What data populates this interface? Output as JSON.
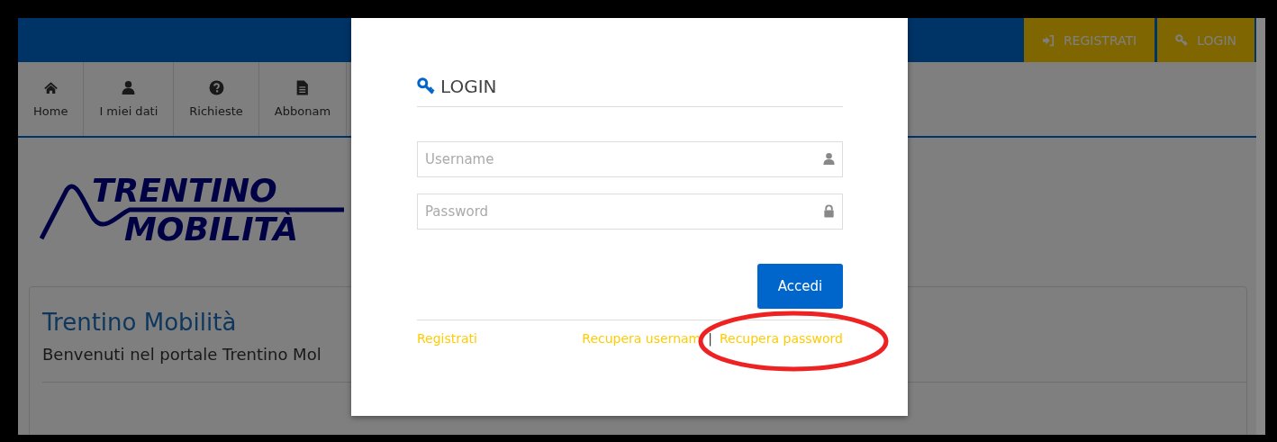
{
  "header": {
    "buttons": [
      {
        "label": "REGISTRATI",
        "kind": "sign-in"
      },
      {
        "label": "LOGIN",
        "kind": "key"
      }
    ]
  },
  "nav": {
    "items": [
      {
        "label": "Home",
        "kind": "home"
      },
      {
        "label": "I miei dati",
        "kind": "user"
      },
      {
        "label": "Richieste",
        "kind": "question"
      },
      {
        "label": "Abbonam",
        "kind": "file"
      }
    ]
  },
  "logo": {
    "line_1": "TRENTINO",
    "line_2": "MOBILITÀ"
  },
  "panel": {
    "title": "Trentino Mobilità",
    "text": "Benvenuti nel portale Trentino Mol"
  },
  "modal": {
    "title": "LOGIN",
    "fields": [
      {
        "placeholder": "Username",
        "kind": "user"
      },
      {
        "placeholder": "Password",
        "kind": "lock"
      }
    ],
    "submit": "Accedi",
    "links": {
      "register": "Registrati",
      "recover_username": "Recupera usernam",
      "separator": "|",
      "recover_password": "Recupera password"
    }
  }
}
